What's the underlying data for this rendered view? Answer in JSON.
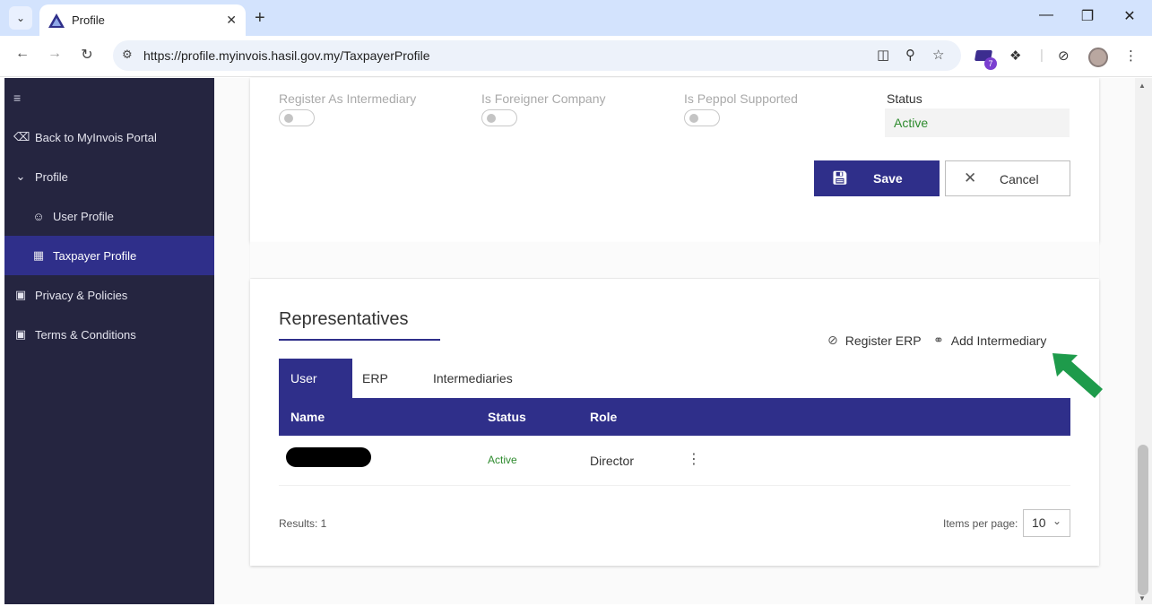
{
  "browser": {
    "tab_title": "Profile",
    "url": "https://profile.myinvois.hasil.gov.my/TaxpayerProfile",
    "extension_badge_count": "7"
  },
  "sidebar": {
    "items": [
      {
        "label": "Back to MyInvois Portal",
        "icon": "circle-arrow-left-icon"
      },
      {
        "label": "Profile",
        "icon": "chevron-down-icon"
      },
      {
        "label": "User Profile",
        "icon": "user-icon"
      },
      {
        "label": "Taxpayer Profile",
        "icon": "building-icon",
        "active": true
      },
      {
        "label": "Privacy & Policies",
        "icon": "book-icon"
      },
      {
        "label": "Terms & Conditions",
        "icon": "book-icon"
      }
    ]
  },
  "profile_form": {
    "register_as_intermediary_label": "Register As Intermediary",
    "is_foreigner_company_label": "Is Foreigner Company",
    "is_peppol_supported_label": "Is Peppol Supported",
    "status_label": "Status",
    "status_value": "Active",
    "save_label": "Save",
    "cancel_label": "Cancel"
  },
  "representatives": {
    "title": "Representatives",
    "register_erp_label": "Register ERP",
    "add_intermediary_label": "Add Intermediary",
    "tabs": [
      "User",
      "ERP",
      "Intermediaries"
    ],
    "active_tab": "User",
    "columns": [
      "Name",
      "Status",
      "Role"
    ],
    "rows": [
      {
        "name": "",
        "status": "Active",
        "role": "Director"
      }
    ],
    "results_text": "Results: 1",
    "items_per_page_label": "Items per page:",
    "items_per_page_value": "10"
  },
  "colors": {
    "brand": "#2f2f8a",
    "sidebar_bg": "#252540",
    "status_active": "#2e8b2e",
    "annotation_arrow": "#1e9b4b"
  }
}
